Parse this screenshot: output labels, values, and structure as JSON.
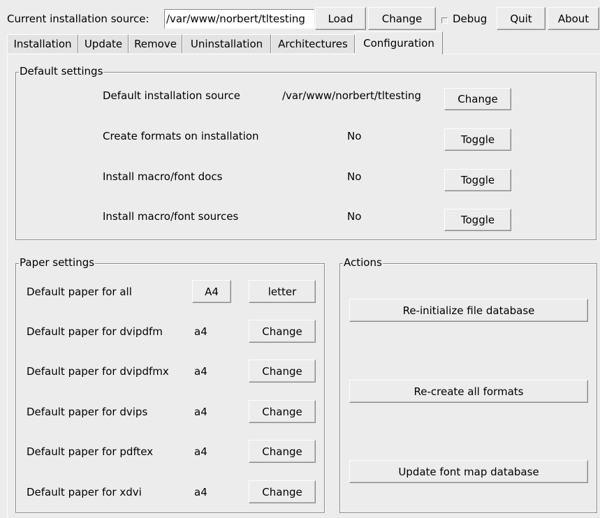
{
  "toolbar": {
    "source_label": "Current installation source:",
    "source_value": "/var/www/norbert/tltesting",
    "load": "Load",
    "change": "Change",
    "debug": "Debug",
    "quit": "Quit",
    "about": "About"
  },
  "tabs": [
    "Installation",
    "Update",
    "Remove",
    "Uninstallation",
    "Architectures",
    "Configuration"
  ],
  "active_tab": "Configuration",
  "default_settings": {
    "title": "Default settings",
    "rows": [
      {
        "label": "Default installation source",
        "value": "/var/www/norbert/tltesting",
        "button": "Change"
      },
      {
        "label": "Create formats on installation",
        "value": "No",
        "button": "Toggle"
      },
      {
        "label": "Install macro/font docs",
        "value": "No",
        "button": "Toggle"
      },
      {
        "label": "Install macro/font sources",
        "value": "No",
        "button": "Toggle"
      }
    ]
  },
  "paper_settings": {
    "title": "Paper settings",
    "all": {
      "label": "Default paper for all",
      "a4": "A4",
      "letter": "letter"
    },
    "rows": [
      {
        "label": "Default paper for dvipdfm",
        "value": "a4",
        "button": "Change"
      },
      {
        "label": "Default paper for dvipdfmx",
        "value": "a4",
        "button": "Change"
      },
      {
        "label": "Default paper for dvips",
        "value": "a4",
        "button": "Change"
      },
      {
        "label": "Default paper for pdftex",
        "value": "a4",
        "button": "Change"
      },
      {
        "label": "Default paper for xdvi",
        "value": "a4",
        "button": "Change"
      }
    ]
  },
  "actions": {
    "title": "Actions",
    "buttons": [
      "Re-initialize file database",
      "Re-create all formats",
      "Update font map database"
    ]
  }
}
